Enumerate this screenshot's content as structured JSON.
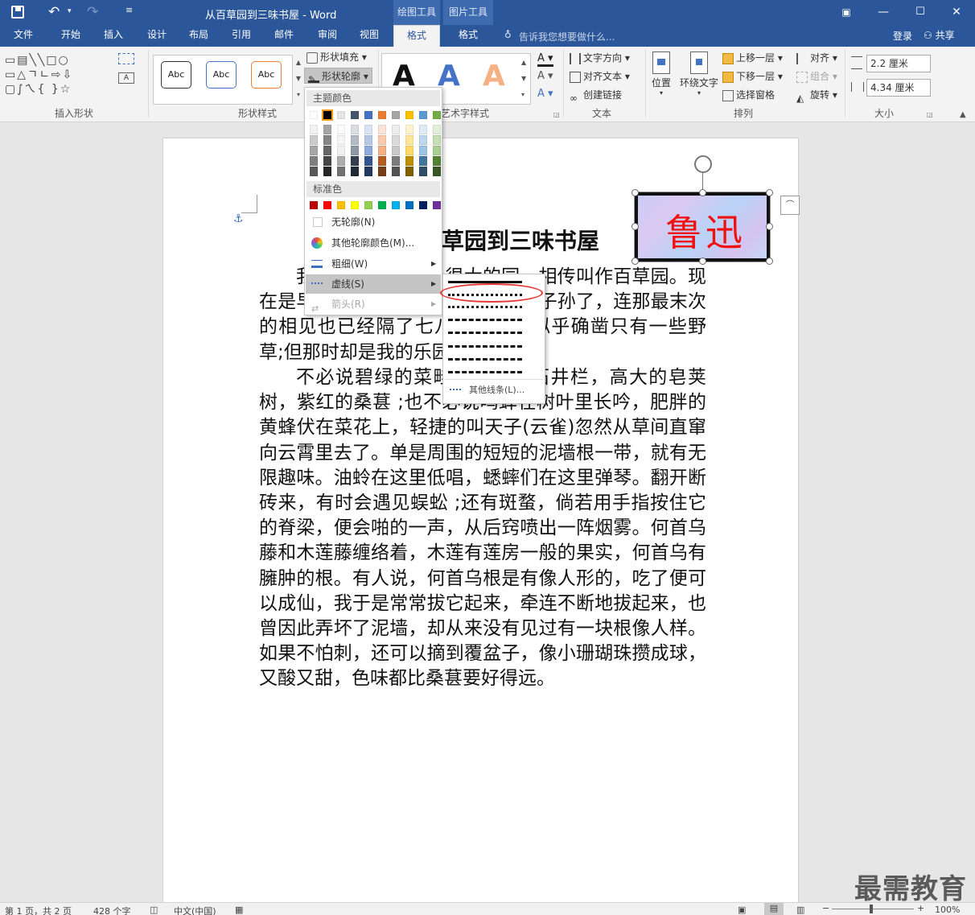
{
  "title": {
    "doc": "从百草园到三味书屋 - Word",
    "tool_draw": "绘图工具",
    "tool_pic": "图片工具"
  },
  "tabs": [
    "文件",
    "开始",
    "插入",
    "设计",
    "布局",
    "引用",
    "邮件",
    "审阅",
    "视图",
    "格式",
    "格式"
  ],
  "tellme": "告诉我您想要做什么...",
  "login": "登录",
  "share": "共享",
  "ribbon": {
    "groups": {
      "insert_shape": "插入形状",
      "shape_style": "形状样式",
      "art_style": "艺术字样式",
      "text": "文本",
      "arrange": "排列",
      "size": "大小"
    },
    "shape_fill": "形状填充",
    "shape_outline": "形状轮廓",
    "abc": "Abc",
    "text_dir": "文字方向",
    "align_text": "对齐文本",
    "create_link": "创建链接",
    "position": "位置",
    "wrap": "环绕文字",
    "bring_fwd": "上移一层",
    "send_back": "下移一层",
    "select_pane": "选择窗格",
    "align": "对齐",
    "group": "组合",
    "rotate": "旋转",
    "height": "2.2 厘米",
    "width": "4.34 厘米"
  },
  "dropdown": {
    "theme_colors": "主题颜色",
    "std_colors": "标准色",
    "no_outline": "无轮廓(N)",
    "more_colors": "其他轮廓颜色(M)...",
    "weight": "粗细(W)",
    "dashes": "虚线(S)",
    "arrows": "箭头(R)",
    "theme_row": [
      "#ffffff",
      "#000000",
      "#e7e6e6",
      "#44546a",
      "#4472c4",
      "#ed7d31",
      "#a5a5a5",
      "#ffc000",
      "#5b9bd5",
      "#70ad47"
    ],
    "std_row": [
      "#c00000",
      "#ff0000",
      "#ffc000",
      "#ffff00",
      "#92d050",
      "#00b050",
      "#00b0f0",
      "#0070c0",
      "#002060",
      "#7030a0"
    ]
  },
  "submenu": {
    "more_lines": "其他线条(L)..."
  },
  "doc": {
    "heading": "草园到三味书屋",
    "textbox": "鲁迅",
    "paragraphs": [
      "我家的后面有一个很大的园，相传叫作百草园。现在是早已并屋子一起卖给朱文公的子孙了，连那最末次的相见也已经隔了七八年，其中似乎确凿只有一些野草;但那时却是我的乐园。",
      "不必说碧绿的菜畦，光滑的石井栏，高大的皂荚树，紫红的桑葚 ;也不必说鸣蝉在树叶里长吟，肥胖的黄蜂伏在菜花上，轻捷的叫天子(云雀)忽然从草间直窜向云霄里去了。单是周围的短短的泥墙根一带，就有无限趣味。油蛉在这里低唱，蟋蟀们在这里弹琴。翻开断砖来，有时会遇见蜈蚣 ;还有斑蝥，倘若用手指按住它的脊梁，便会啪的一声，从后窍喷出一阵烟雾。何首乌藤和木莲藤缠络着，木莲有莲房一般的果实，何首乌有臃肿的根。有人说，何首乌根是有像人形的，吃了便可以成仙，我于是常常拔它起来，牵连不断地拔起来，也曾因此弄坏了泥墙，却从来没有见过有一块根像人样。如果不怕刺，还可以摘到覆盆子，像小珊瑚珠攒成球，又酸又甜，色味都比桑葚要好得远。"
    ]
  },
  "status": {
    "page": "第 1 页，共 2 页",
    "words": "428 个字",
    "lang": "中文(中国)",
    "zoom": "100%"
  },
  "watermark": "最需教育"
}
